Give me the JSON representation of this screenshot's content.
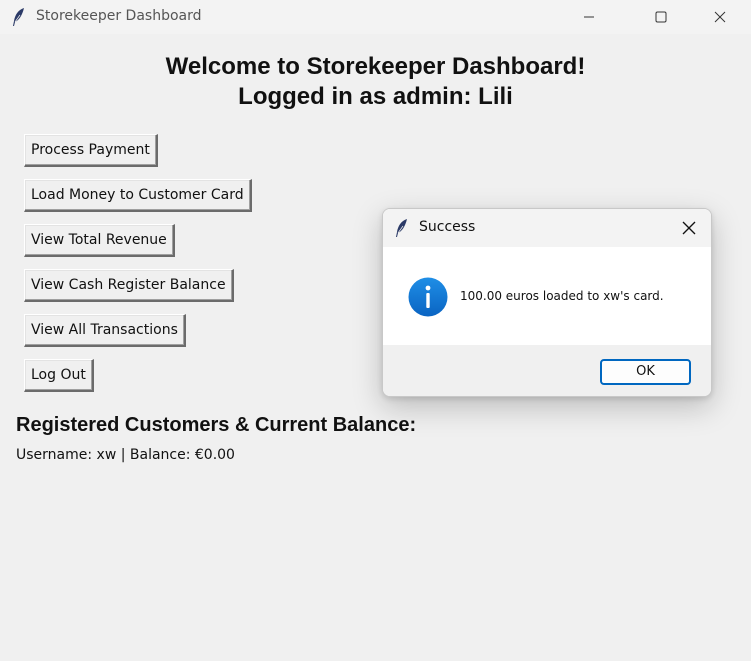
{
  "window": {
    "title": "Storekeeper Dashboard",
    "app_icon": "feather-icon"
  },
  "heading": {
    "line1": "Welcome to Storekeeper Dashboard!",
    "line2": "Logged in as admin: Lili"
  },
  "actions": [
    {
      "label": "Process Payment"
    },
    {
      "label": "Load Money to Customer Card"
    },
    {
      "label": "View Total Revenue"
    },
    {
      "label": "View Cash Register Balance"
    },
    {
      "label": "View All Transactions"
    },
    {
      "label": "Log Out"
    }
  ],
  "customers": {
    "section_title": "Registered Customers & Current Balance:",
    "items": [
      {
        "line": "Username: xw | Balance: €0.00"
      }
    ]
  },
  "dialog": {
    "title": "Success",
    "icon": "info-icon",
    "message": "100.00 euros loaded to xw's card.",
    "ok_label": "OK",
    "accent_color": "#0067c0"
  }
}
